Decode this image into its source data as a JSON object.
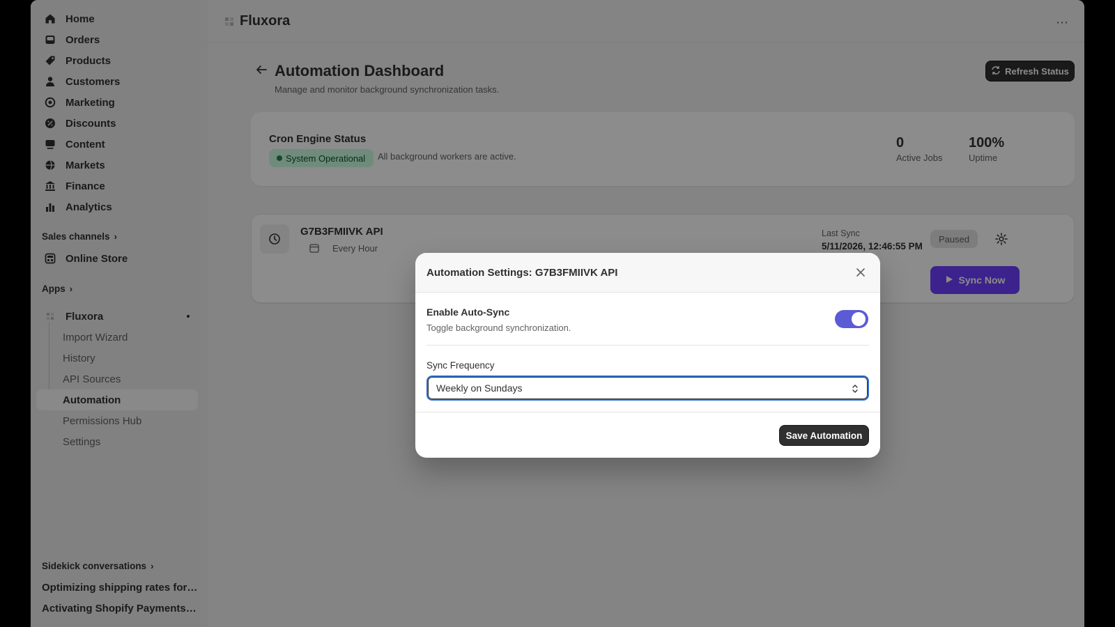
{
  "sidebar": {
    "nav": [
      {
        "label": "Home",
        "icon": "home-icon"
      },
      {
        "label": "Orders",
        "icon": "inbox-icon"
      },
      {
        "label": "Products",
        "icon": "tag-icon"
      },
      {
        "label": "Customers",
        "icon": "person-icon"
      },
      {
        "label": "Marketing",
        "icon": "target-icon"
      },
      {
        "label": "Discounts",
        "icon": "discount-icon"
      },
      {
        "label": "Content",
        "icon": "content-icon"
      },
      {
        "label": "Markets",
        "icon": "globe-icon"
      },
      {
        "label": "Finance",
        "icon": "bank-icon"
      },
      {
        "label": "Analytics",
        "icon": "bar-chart-icon"
      }
    ],
    "sales_channels": "Sales channels",
    "online_store": "Online Store",
    "apps": "Apps",
    "app_name": "Fluxora",
    "app_items": [
      "Import Wizard",
      "History",
      "API Sources",
      "Automation",
      "Permissions Hub",
      "Settings"
    ],
    "sidekick": "Sidekick conversations",
    "conversations": [
      "Optimizing shipping rates for s...",
      "Activating Shopify Payments f..."
    ]
  },
  "topbar": {
    "title": "Fluxora",
    "more": "⋯"
  },
  "page": {
    "title": "Automation Dashboard",
    "subtitle": "Manage and monitor background synchronization tasks.",
    "refresh_label": "Refresh Status"
  },
  "status": {
    "title": "Cron Engine Status",
    "badge": "System Operational",
    "note": "All background workers are active.",
    "active_jobs_value": "0",
    "active_jobs_label": "Active Jobs",
    "uptime_value": "100%",
    "uptime_label": "Uptime"
  },
  "job": {
    "name": "G7B3FMIIVK API",
    "frequency": "Every Hour",
    "last_sync_label": "Last Sync",
    "last_sync_value": "5/11/2026, 12:46:55 PM",
    "state": "Paused",
    "sync_label": "Sync Now"
  },
  "modal": {
    "title": "Automation Settings: G7B3FMIIVK API",
    "toggle_label": "Enable Auto-Sync",
    "toggle_desc": "Toggle background synchronization.",
    "toggle_on": true,
    "freq_label": "Sync Frequency",
    "freq_value": "Weekly on Sundays",
    "save_label": "Save Automation"
  },
  "colors": {
    "accent": "#6e3fff",
    "toggle": "#5b5bd6",
    "success_bg": "#cdfee1",
    "dark_button": "#303030"
  }
}
